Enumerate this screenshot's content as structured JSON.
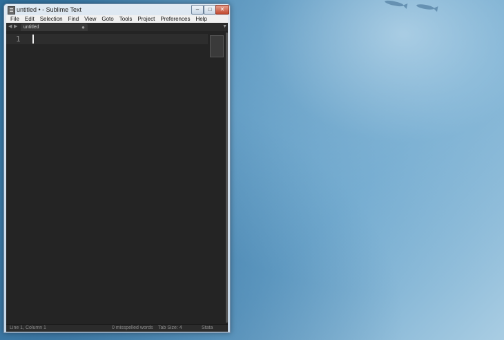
{
  "window": {
    "title": "untitled • - Sublime Text",
    "controls": {
      "minimize": "–",
      "maximize": "□",
      "close": "✕"
    }
  },
  "menubar": [
    "File",
    "Edit",
    "Selection",
    "Find",
    "View",
    "Goto",
    "Tools",
    "Project",
    "Preferences",
    "Help"
  ],
  "tabs": {
    "prev": "◀",
    "next": "▶",
    "items": [
      {
        "label": "untitled",
        "close": "●"
      }
    ],
    "dropdown": "▼"
  },
  "editor": {
    "line_numbers": [
      "1"
    ],
    "content": ""
  },
  "statusbar": {
    "position": "Line 1, Column 1",
    "spelling": "0 misspelled words",
    "tab_size": "Tab Size: 4",
    "syntax": "Stata"
  },
  "colors": {
    "editor_bg": "#242424",
    "current_line": "#2d2d2d",
    "chrome": "#2b2b2b",
    "desktop_accent": "#4a8bb8"
  }
}
